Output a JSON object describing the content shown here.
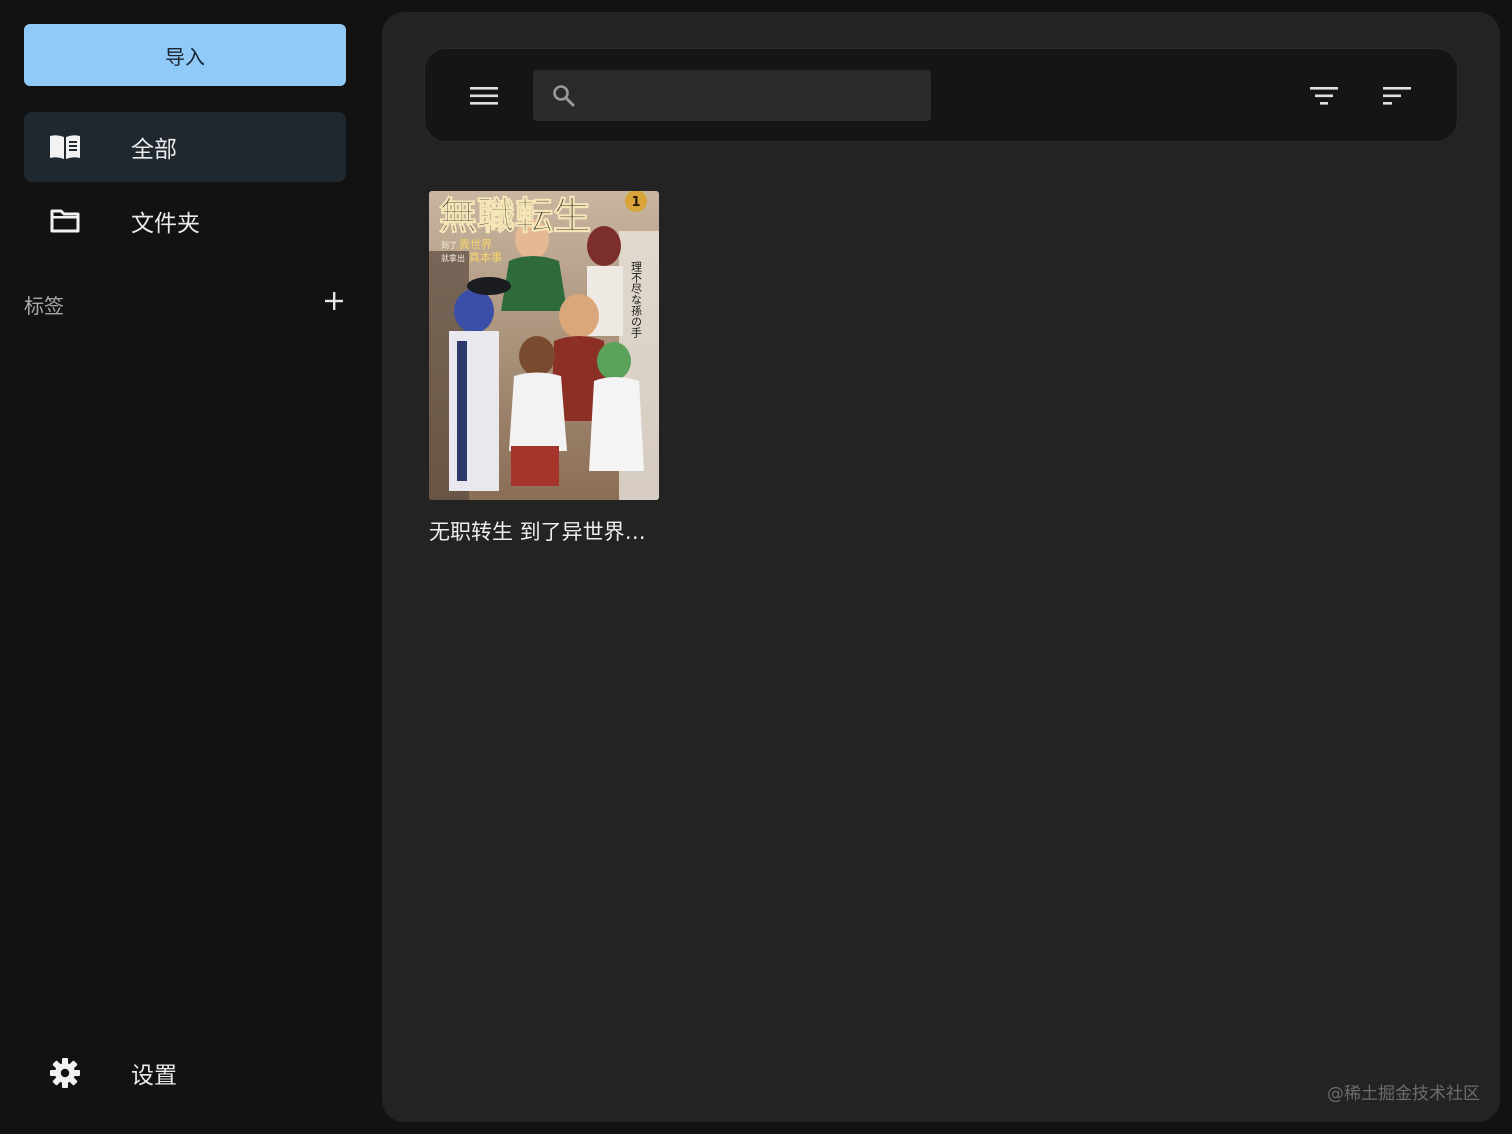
{
  "sidebar": {
    "import_label": "导入",
    "nav": [
      {
        "label": "全部",
        "icon": "book-open-icon",
        "active": true
      },
      {
        "label": "文件夹",
        "icon": "folder-icon",
        "active": false
      }
    ],
    "tags_title": "标签",
    "settings_label": "设置"
  },
  "toolbar": {
    "search": {
      "value": "",
      "placeholder": ""
    }
  },
  "library": {
    "books": [
      {
        "title": "无职转生 到了异世界就拿出真本事",
        "cover_text": {
          "main": "無職転生",
          "vol": "1",
          "sub1a": "到了",
          "sub1b": "異世界",
          "sub2a": "就拿出",
          "sub2b": "真本事",
          "author": "理不尽な孫の手"
        }
      }
    ]
  },
  "watermark": "@稀土掘金技术社区",
  "colors": {
    "accent": "#90caf9",
    "sidebar_bg": "#121212",
    "panel_bg": "#232323",
    "toolbar_bg": "#151515",
    "active_item_bg": "#1f272f"
  }
}
